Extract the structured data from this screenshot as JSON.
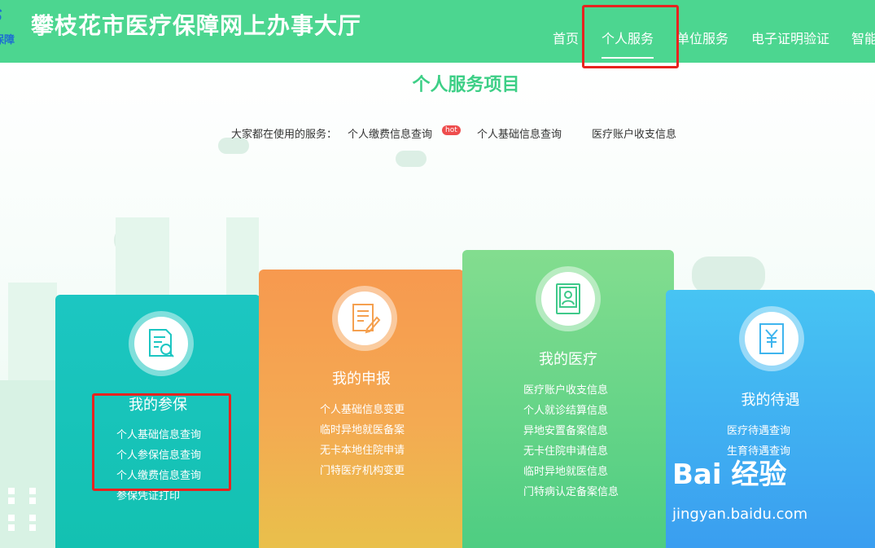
{
  "header": {
    "logo": {
      "mark": "S",
      "text": "保障"
    },
    "site_title": "攀枝花市医疗保障网上办事大厅",
    "nav": [
      {
        "label": "首页"
      },
      {
        "label": "个人服务",
        "active": true
      },
      {
        "label": "单位服务"
      },
      {
        "label": "电子证明验证"
      },
      {
        "label": "智能"
      }
    ],
    "colors": {
      "bg": "#4cd690",
      "highlight_box": "#e8231f"
    }
  },
  "main": {
    "title": "个人服务项目",
    "popular": {
      "label": "大家都在使用的服务：",
      "items": [
        {
          "label": "个人缴费信息查询",
          "badge": "hot"
        },
        {
          "label": "个人基础信息查询"
        },
        {
          "label": "医疗账户收支信息"
        }
      ]
    },
    "cards": [
      {
        "title": "我的参保",
        "icon": "document-search-icon",
        "color": "#1cc6c2",
        "items": [
          "个人基础信息查询",
          "个人参保信息查询",
          "个人缴费信息查询",
          "参保凭证打印"
        ]
      },
      {
        "title": "我的申报",
        "icon": "document-edit-icon",
        "color": "#f7994f",
        "items": [
          "个人基础信息变更",
          "临时异地就医备案",
          "无卡本地住院申请",
          "门特医疗机构变更"
        ]
      },
      {
        "title": "我的医疗",
        "icon": "user-card-icon",
        "color": "#83dd8f",
        "items": [
          "医疗账户收支信息",
          "个人就诊结算信息",
          "异地安置备案信息",
          "无卡住院申请信息",
          "临时异地就医信息",
          "门特病认定备案信息"
        ]
      },
      {
        "title": "我的待遇",
        "icon": "yuan-document-icon",
        "color": "#47c4f3",
        "items": [
          "医疗待遇查询",
          "生育待遇查询"
        ]
      }
    ]
  },
  "watermark": {
    "brand": "Bai 经验",
    "url": "jingyan.baidu.com"
  }
}
